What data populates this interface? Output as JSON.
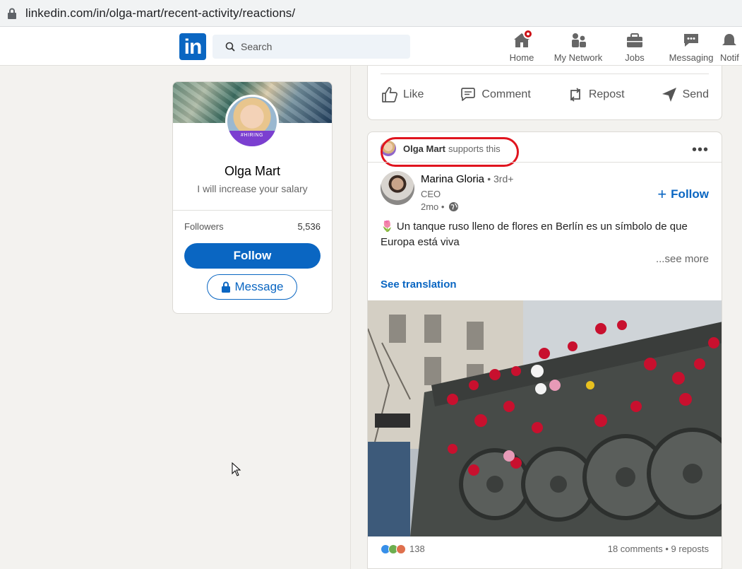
{
  "browser": {
    "url": "linkedin.com/in/olga-mart/recent-activity/reactions/"
  },
  "nav": {
    "logo": "in",
    "search_placeholder": "Search",
    "items": [
      {
        "label": "Home"
      },
      {
        "label": "My Network"
      },
      {
        "label": "Jobs"
      },
      {
        "label": "Messaging"
      },
      {
        "label": "Notif"
      }
    ]
  },
  "profile": {
    "name": "Olga Mart",
    "tagline": "I will increase your salary",
    "badge": "#HIRING",
    "followers_label": "Followers",
    "followers_count": "5,536",
    "follow_label": "Follow",
    "message_label": "Message"
  },
  "prev_post": {
    "actions": [
      {
        "label": "Like"
      },
      {
        "label": "Comment"
      },
      {
        "label": "Repost"
      },
      {
        "label": "Send"
      }
    ]
  },
  "post": {
    "reactor_name": "Olga Mart",
    "reaction_text": "supports this",
    "more": "•••",
    "author_name": "Marina Gloria",
    "author_degree": "• 3rd+",
    "author_title": "CEO",
    "time": "2mo •",
    "follow_label": "Follow",
    "text": "Un tanque ruso lleno de flores en Berlín es un símbolo de que Europa está viva",
    "emoji": "🌷",
    "see_more": "...see more",
    "see_translation": "See translation",
    "reaction_count": "138",
    "comments_reposts": "18 comments • 9 reposts"
  },
  "colors": {
    "brand": "#0a66c2",
    "highlight": "#e0141e",
    "notification": "#cc1016"
  }
}
